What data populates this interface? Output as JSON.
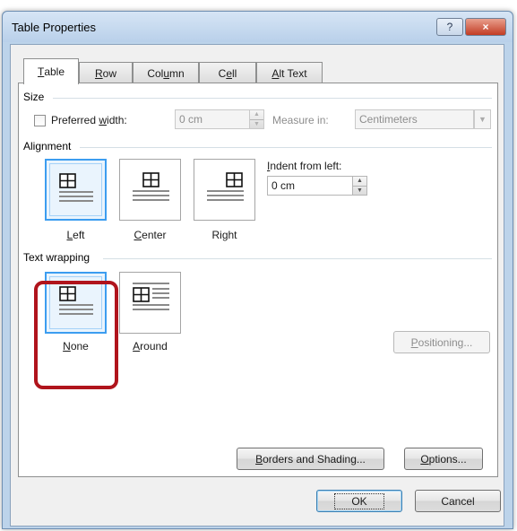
{
  "window": {
    "title": "Table Properties",
    "help_icon": "?",
    "close_icon": "×"
  },
  "tabs": [
    {
      "pre": "",
      "ul": "T",
      "post": "able",
      "active": true
    },
    {
      "pre": "",
      "ul": "R",
      "post": "ow",
      "active": false
    },
    {
      "pre": "Col",
      "ul": "u",
      "post": "mn",
      "active": false
    },
    {
      "pre": "C",
      "ul": "e",
      "post": "ll",
      "active": false
    },
    {
      "pre": "",
      "ul": "A",
      "post": "lt Text",
      "active": false
    }
  ],
  "size": {
    "group_label": "Size",
    "preferred_width": {
      "pre": "Preferred ",
      "ul": "w",
      "post": "idth:",
      "checked": false
    },
    "width_value": "0 cm",
    "measure_label": "Measure in:",
    "measure_value": "Centimeters"
  },
  "alignment": {
    "group_label": "Alignment",
    "options": [
      {
        "pre": "",
        "ul": "L",
        "post": "eft",
        "selected": true,
        "icon": "align-left-icon"
      },
      {
        "pre": "",
        "ul": "C",
        "post": "enter",
        "selected": false,
        "icon": "align-center-icon"
      },
      {
        "pre": "Ri",
        "ul": "g",
        "post": "ht",
        "selected": false,
        "icon": "align-right-icon"
      }
    ],
    "indent_label": {
      "pre": "",
      "ul": "I",
      "post": "ndent from left:"
    },
    "indent_value": "0 cm"
  },
  "text_wrapping": {
    "group_label": "Text wrapping",
    "options": [
      {
        "pre": "",
        "ul": "N",
        "post": "one",
        "selected": true,
        "icon": "wrap-none-icon"
      },
      {
        "pre": "",
        "ul": "A",
        "post": "round",
        "selected": false,
        "icon": "wrap-around-icon"
      }
    ],
    "positioning_label": {
      "pre": "",
      "ul": "P",
      "post": "ositioning..."
    }
  },
  "buttons": {
    "borders_shading": {
      "pre": "",
      "ul": "B",
      "post": "orders and Shading..."
    },
    "options": {
      "pre": "",
      "ul": "O",
      "post": "ptions..."
    },
    "ok": "OK",
    "cancel": "Cancel"
  },
  "colors": {
    "selection_border": "#3c9df0",
    "highlight": "#b0141c",
    "titlebar": "#c9dcf0"
  }
}
